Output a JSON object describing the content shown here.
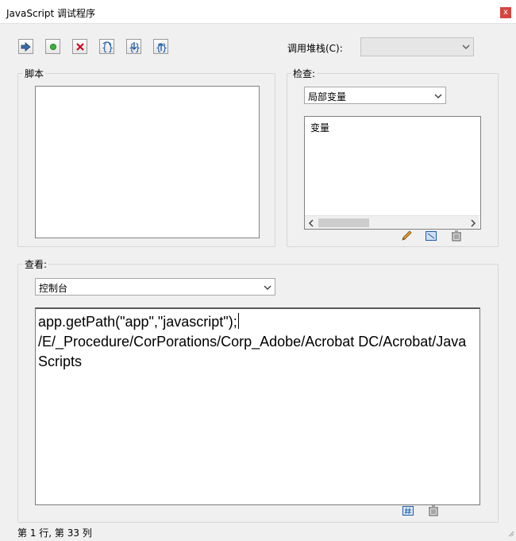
{
  "window": {
    "title": "JavaScript 调试程序",
    "close_label": "x"
  },
  "toolbar": {
    "buttons": [
      {
        "name": "resume-button",
        "icon": "arrow-right-icon"
      },
      {
        "name": "breakpoint-button",
        "icon": "green-dot-icon"
      },
      {
        "name": "stop-button",
        "icon": "red-x-icon"
      },
      {
        "name": "step-over-button",
        "icon": "step-over-icon"
      },
      {
        "name": "step-into-button",
        "icon": "step-into-icon"
      },
      {
        "name": "step-out-button",
        "icon": "step-out-icon"
      }
    ]
  },
  "call_stack": {
    "label": "调用堆栈(C):",
    "value": ""
  },
  "script_group": {
    "title": "脚本"
  },
  "inspect_group": {
    "title": "检查:",
    "scope_value": "局部变量",
    "column_header": "变量",
    "buttons": [
      {
        "name": "edit-variable-button",
        "icon": "pencil-icon"
      },
      {
        "name": "toggle-view-button",
        "icon": "grid-icon"
      },
      {
        "name": "delete-variable-button",
        "icon": "trash-icon"
      }
    ]
  },
  "view_group": {
    "title": "查看:",
    "view_value": "控制台",
    "console_lines": [
      "app.getPath(\"app\",\"javascript\");",
      "/E/_Procedure/CorPorations/Corp_Adobe/Acrobat DC/Acrobat/JavaScripts"
    ],
    "buttons": [
      {
        "name": "console-run-button",
        "icon": "hash-icon"
      },
      {
        "name": "console-clear-button",
        "icon": "trash-icon"
      }
    ]
  },
  "status": {
    "text": "第 1 行, 第 33 列"
  },
  "colors": {
    "close": "#d64541",
    "accent": "#1e5aa8",
    "breakpoint": "#3cb13c",
    "stop": "#d0021b"
  }
}
